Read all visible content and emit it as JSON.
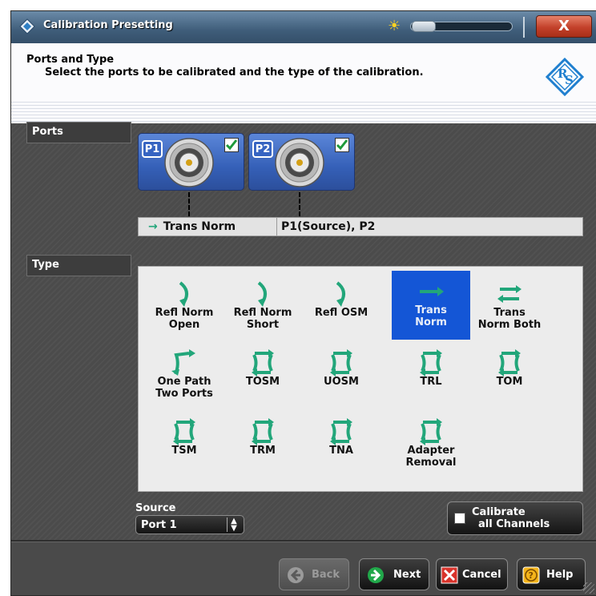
{
  "window": {
    "title": "Calibration Presetting",
    "close_label": "X"
  },
  "header": {
    "title": "Ports and Type",
    "subtitle": "Select the ports to be calibrated and the type of the calibration."
  },
  "ports_section": {
    "label": "Ports",
    "ports": [
      {
        "badge": "P1",
        "checked": true
      },
      {
        "badge": "P2",
        "checked": true
      }
    ],
    "connection": {
      "type": "Trans Norm",
      "ports": "P1(Source), P2"
    }
  },
  "type_section": {
    "label": "Type",
    "selected": "Trans Norm",
    "items": [
      {
        "line1": "Refl Norm",
        "line2": "Open",
        "icon": "refl-arrow-icon"
      },
      {
        "line1": "Refl Norm",
        "line2": "Short",
        "icon": "refl-arrow-icon"
      },
      {
        "line1": "Refl OSM",
        "line2": "",
        "icon": "refl-arrow-icon"
      },
      {
        "line1": "Trans",
        "line2": "Norm",
        "icon": "trans-arrow-icon"
      },
      {
        "line1": "Trans",
        "line2": "Norm Both",
        "icon": "trans-both-arrows-icon"
      },
      {
        "line1": "One Path",
        "line2": "Two Ports",
        "icon": "one-path-arrow-icon"
      },
      {
        "line1": "TOSM",
        "line2": "",
        "icon": "two-port-loop-icon"
      },
      {
        "line1": "UOSM",
        "line2": "",
        "icon": "two-port-loop-icon"
      },
      {
        "line1": "TRL",
        "line2": "",
        "icon": "two-port-loop-icon"
      },
      {
        "line1": "TOM",
        "line2": "",
        "icon": "two-port-loop-icon"
      },
      {
        "line1": "TSM",
        "line2": "",
        "icon": "two-port-loop-icon"
      },
      {
        "line1": "TRM",
        "line2": "",
        "icon": "two-port-loop-icon"
      },
      {
        "line1": "TNA",
        "line2": "",
        "icon": "two-port-loop-icon"
      },
      {
        "line1": "Adapter",
        "line2": "Removal",
        "icon": "two-port-loop-icon"
      }
    ]
  },
  "source": {
    "label": "Source",
    "value": "Port 1"
  },
  "calibrate_all": {
    "line1": "Calibrate",
    "line2": "all Channels",
    "checked": false
  },
  "footer": {
    "back_label": "Back",
    "next_label": "Next",
    "cancel_label": "Cancel",
    "help_label": "Help"
  },
  "colors": {
    "accent_green": "#22a67a",
    "selection_blue": "#1456d6",
    "port_blue": "#3560b8"
  }
}
